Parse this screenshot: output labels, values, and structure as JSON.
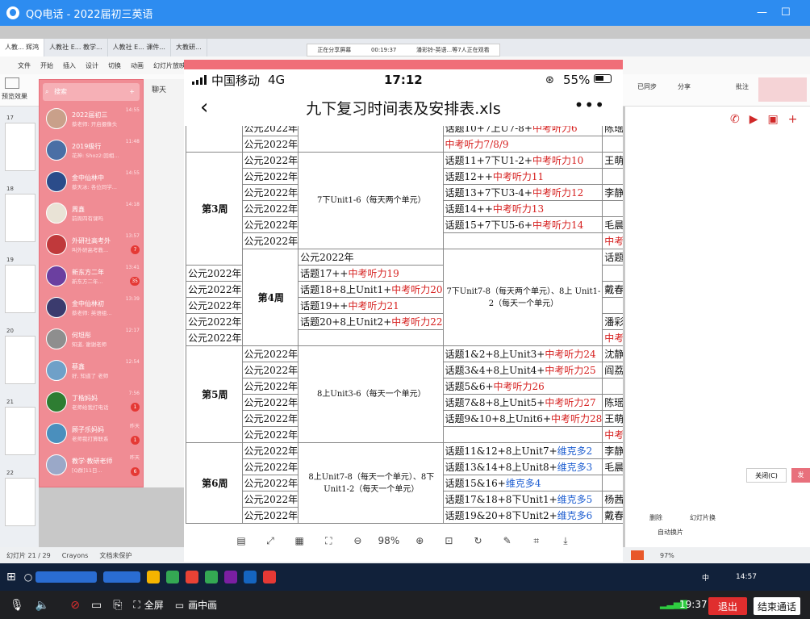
{
  "window": {
    "title": "QQ电话  -  2022届初三英语"
  },
  "share_banner": {
    "status": "正在分享屏幕",
    "timer": "00:19:37",
    "viewers": "潘彩铃-英语...等7人正在观看"
  },
  "ppt": {
    "tabs": [
      "人教... 辉鸿",
      "人教社 E... 教学...",
      "人教社 E... 课件...",
      "大教研..."
    ],
    "menu": [
      "文件",
      "开始",
      "插入",
      "设计",
      "切换",
      "动画",
      "幻灯片放映",
      "审阅",
      "视图"
    ],
    "ribbon_left": "预览效果",
    "right_labels": {
      "share": "分享",
      "sync": "已同步",
      "annotate": "批注",
      "close": "关闭(C)",
      "send": "发"
    },
    "right_buttons": {
      "delete": "删除",
      "slide_switch": "幻灯片换",
      "auto_switch": "自动换片"
    },
    "status_items": [
      "幻灯片 21 / 29",
      "Crayons",
      "文档未保护"
    ],
    "zoom": "97%",
    "slide_numbers": [
      "17",
      "18",
      "19",
      "20",
      "21",
      "22"
    ]
  },
  "qq": {
    "search_placeholder": "搜索",
    "contacts": [
      {
        "name": "2022届初三",
        "msg": "蔡老师: 开启摄像头",
        "time": "14:55",
        "badge": "",
        "color": "#c9a08a"
      },
      {
        "name": "2019级行",
        "msg": "花神: Shoz2:回相...",
        "time": "11:48",
        "badge": "",
        "color": "#4a6fa5"
      },
      {
        "name": "金中仙林中",
        "msg": "蔡天冰: 各位同学...",
        "time": "14:55",
        "badge": "",
        "color": "#2b4c8a"
      },
      {
        "name": "周鑫",
        "msg": "前周四有课吗",
        "time": "14:18",
        "badge": "",
        "color": "#e9e3d6"
      },
      {
        "name": "外研社高考外",
        "msg": "叫外研高考教...",
        "time": "13:57",
        "badge": "7",
        "color": "#c0393b"
      },
      {
        "name": "新东方二年",
        "msg": "新东方二年...",
        "time": "13:41",
        "badge": "35",
        "color": "#6b3fa0"
      },
      {
        "name": "金中仙林初",
        "msg": "蔡老师: 英语组...",
        "time": "13:39",
        "badge": "",
        "color": "#3b3b6e"
      },
      {
        "name": "何坦彤",
        "msg": "知道, 谢谢老师",
        "time": "12:17",
        "badge": "",
        "color": "#8e8e8e"
      },
      {
        "name": "蔡鑫",
        "msg": "好, 知道了 老师",
        "time": "12:54",
        "badge": "",
        "color": "#6fa0c8"
      },
      {
        "name": "丁楷妈妈",
        "msg": "老师给我打电话",
        "time": "7:56",
        "badge": "1",
        "color": "#2e7d32"
      },
      {
        "name": "顾子乐妈妈",
        "msg": "老师我打算联系",
        "time": "昨天",
        "badge": "1",
        "color": "#4a8fbd"
      },
      {
        "name": "教学·教研老师",
        "msg": "[Q群]11日...",
        "time": "昨天",
        "badge": "6",
        "color": "#9aa8c8"
      }
    ],
    "chat_title": "聊天"
  },
  "phone": {
    "carrier": "中国移动",
    "network": "4G",
    "time": "17:12",
    "battery": "55%",
    "doc_title": "九下复习时间表及安排表.xls",
    "back_label": "‹",
    "more_label": "•••",
    "zoom": "98%"
  },
  "table": {
    "date_text": "公元2022年",
    "rows": [
      {
        "week": "",
        "week_span": 0,
        "range": "",
        "range_span": 0,
        "parts": [
          [
            "话题10+7上U7-8+",
            "k"
          ],
          [
            "中考听力6",
            "r"
          ]
        ],
        "teacher": "陈瑶"
      },
      {
        "parts": [
          [
            "中考听力7/8/9",
            "r"
          ]
        ],
        "teacher": ""
      },
      {
        "week": "第3周",
        "week_span": 7,
        "range": "7下Unit1-6（每天两个单元）",
        "range_span": 6,
        "parts": [
          [
            "话题11+7下U1-2+",
            "k"
          ],
          [
            "中考听力10",
            "r"
          ]
        ],
        "teacher": "王萌"
      },
      {
        "parts": [
          [
            "话题12++",
            "k"
          ],
          [
            "中考听力11",
            "r"
          ]
        ],
        "teacher": ""
      },
      {
        "parts": [
          [
            "话题13+7下U3-4+",
            "k"
          ],
          [
            "中考听力12",
            "r"
          ]
        ],
        "teacher": "李静"
      },
      {
        "parts": [
          [
            "话题14++",
            "k"
          ],
          [
            "中考听力13",
            "r"
          ]
        ],
        "teacher": ""
      },
      {
        "parts": [
          [
            "话题15+7下U5-6+",
            "k"
          ],
          [
            "中考听力14",
            "r"
          ]
        ],
        "teacher": "毛晨卉"
      },
      {
        "parts": [
          [
            "中考听力15/16/17",
            "r"
          ]
        ],
        "teacher": ""
      },
      {
        "week": "第4周",
        "week_span": 6,
        "range": "7下Unit7-8（每天两个单元）、8上 Unit1-2（每天一个单元）",
        "range_span": 6,
        "parts": [
          [
            "话题16+7下U7-8+",
            "k"
          ],
          [
            "中考听力18",
            "r"
          ]
        ],
        "teacher": "杨茜"
      },
      {
        "parts": [
          [
            "话题17++",
            "k"
          ],
          [
            "中考听力19",
            "r"
          ]
        ],
        "teacher": ""
      },
      {
        "parts": [
          [
            "话题18+8上Unit1+",
            "k"
          ],
          [
            "中考听力20",
            "r"
          ]
        ],
        "teacher": "戴春晓"
      },
      {
        "parts": [
          [
            "话题19++",
            "k"
          ],
          [
            "中考听力21",
            "r"
          ]
        ],
        "teacher": ""
      },
      {
        "parts": [
          [
            "话题20+8上Unit2+",
            "k"
          ],
          [
            "中考听力22",
            "r"
          ]
        ],
        "teacher": "潘彩铃"
      },
      {
        "parts": [
          [
            "中考听力23",
            "r"
          ]
        ],
        "teacher": ""
      },
      {
        "week": "第5周",
        "week_span": 6,
        "range": "8上Unit3-6（每天一个单元）",
        "range_span": 6,
        "parts": [
          [
            "话题1&2+8上Unit3+",
            "k"
          ],
          [
            "中考听力24",
            "r"
          ]
        ],
        "teacher": "沈静盈"
      },
      {
        "parts": [
          [
            "话题3&4+8上Unit4+",
            "k"
          ],
          [
            "中考听力25",
            "r"
          ]
        ],
        "teacher": "阎荔"
      },
      {
        "parts": [
          [
            "话题5&6+",
            "k"
          ],
          [
            "中考听力26",
            "r"
          ]
        ],
        "teacher": ""
      },
      {
        "parts": [
          [
            "话题7&8+8上Unit5+",
            "k"
          ],
          [
            "中考听力27",
            "r"
          ]
        ],
        "teacher": "陈瑶"
      },
      {
        "parts": [
          [
            "话题9&10+8上Unit6+",
            "k"
          ],
          [
            "中考听力28",
            "r"
          ]
        ],
        "teacher": "王萌"
      },
      {
        "parts": [
          [
            "中考听力29/30+",
            "r"
          ],
          [
            "维克多1",
            "b"
          ]
        ],
        "teacher": ""
      },
      {
        "week": "第6周",
        "week_span": 5,
        "range": "8上Unit7-8（每天一个单元）、8下 Unit1-2（每天一个单元）",
        "range_span": 5,
        "parts": [
          [
            "话题11&12+8上Unit7+",
            "k"
          ],
          [
            "维克多2",
            "b"
          ]
        ],
        "teacher": "李静"
      },
      {
        "parts": [
          [
            "话题13&14+8上Unit8+",
            "k"
          ],
          [
            "维克多3",
            "b"
          ]
        ],
        "teacher": "毛晨卉"
      },
      {
        "parts": [
          [
            "话题15&16+",
            "k"
          ],
          [
            "维克多4",
            "b"
          ]
        ],
        "teacher": ""
      },
      {
        "parts": [
          [
            "话题17&18+8下Unit1+",
            "k"
          ],
          [
            "维克多5",
            "b"
          ]
        ],
        "teacher": "杨茜"
      },
      {
        "parts": [
          [
            "话题19&20+8下Unit2+",
            "k"
          ],
          [
            "维克多6",
            "b"
          ]
        ],
        "teacher": "戴春晓"
      }
    ]
  },
  "callbar": {
    "fullscreen": "全屏",
    "pip": "画中画",
    "duration": "19:37",
    "exit": "退出",
    "end": "结束通话"
  },
  "taskbar": {
    "time": "14:57",
    "input_lang": "中"
  },
  "colors": {
    "accent_blue": "#2d8cf0",
    "qq_pink": "#f08c94",
    "text_red": "#d6201f",
    "text_blue": "#1f5fd1",
    "exit_red": "#e02e2e"
  }
}
